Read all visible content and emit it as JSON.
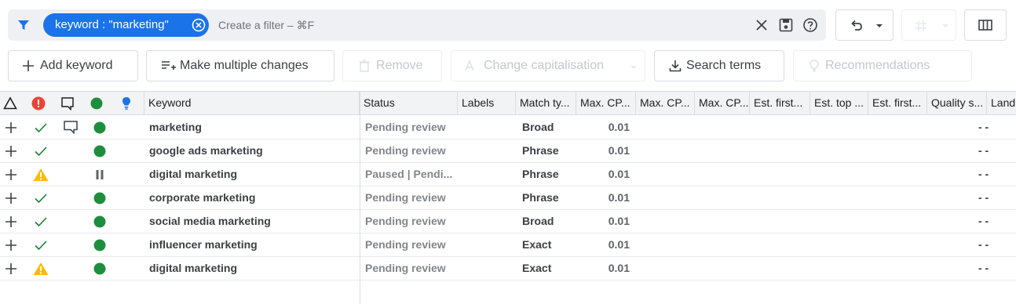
{
  "filter": {
    "chip_label": "keyword : \"marketing\"",
    "placeholder": "Create a filter – ⌘F"
  },
  "actions": {
    "add_keyword": "Add keyword",
    "make_multiple_changes": "Make multiple changes",
    "remove": "Remove",
    "change_capitalisation": "Change capitalisation",
    "search_terms": "Search terms",
    "recommendations": "Recommendations"
  },
  "columns": {
    "keyword": "Keyword",
    "status": "Status",
    "labels": "Labels",
    "match_type": "Match ty...",
    "max_cpc_1": "Max. CP...",
    "max_cpc_2": "Max. CP...",
    "max_cpc_3": "Max. CP...",
    "est_first_1": "Est. first...",
    "est_top": "Est. top ...",
    "est_first_2": "Est. first...",
    "quality": "Quality s...",
    "landing": "Landi"
  },
  "rows": [
    {
      "keyword": "marketing",
      "status": "Pending review",
      "match": "Broad",
      "cpc": "0.01",
      "quality": "- -",
      "alert": "check",
      "comment": true,
      "state": "enabled"
    },
    {
      "keyword": "google ads marketing",
      "status": "Pending review",
      "match": "Phrase",
      "cpc": "0.01",
      "quality": "- -",
      "alert": "check",
      "comment": false,
      "state": "enabled"
    },
    {
      "keyword": "digital marketing",
      "status": "Paused | Pendi...",
      "match": "Phrase",
      "cpc": "0.01",
      "quality": "- -",
      "alert": "warning",
      "comment": false,
      "state": "paused"
    },
    {
      "keyword": "corporate marketing",
      "status": "Pending review",
      "match": "Phrase",
      "cpc": "0.01",
      "quality": "- -",
      "alert": "check",
      "comment": false,
      "state": "enabled"
    },
    {
      "keyword": "social media marketing",
      "status": "Pending review",
      "match": "Broad",
      "cpc": "0.01",
      "quality": "- -",
      "alert": "check",
      "comment": false,
      "state": "enabled"
    },
    {
      "keyword": "influencer marketing",
      "status": "Pending review",
      "match": "Exact",
      "cpc": "0.01",
      "quality": "- -",
      "alert": "check",
      "comment": false,
      "state": "enabled"
    },
    {
      "keyword": "digital marketing",
      "status": "Pending review",
      "match": "Exact",
      "cpc": "0.01",
      "quality": "- -",
      "alert": "warning",
      "comment": false,
      "state": "enabled"
    }
  ],
  "colors": {
    "accent": "#1a73e8",
    "enabled": "#1e8e3e",
    "error": "#ea4335",
    "warning": "#fbbc04",
    "check": "#188038"
  }
}
